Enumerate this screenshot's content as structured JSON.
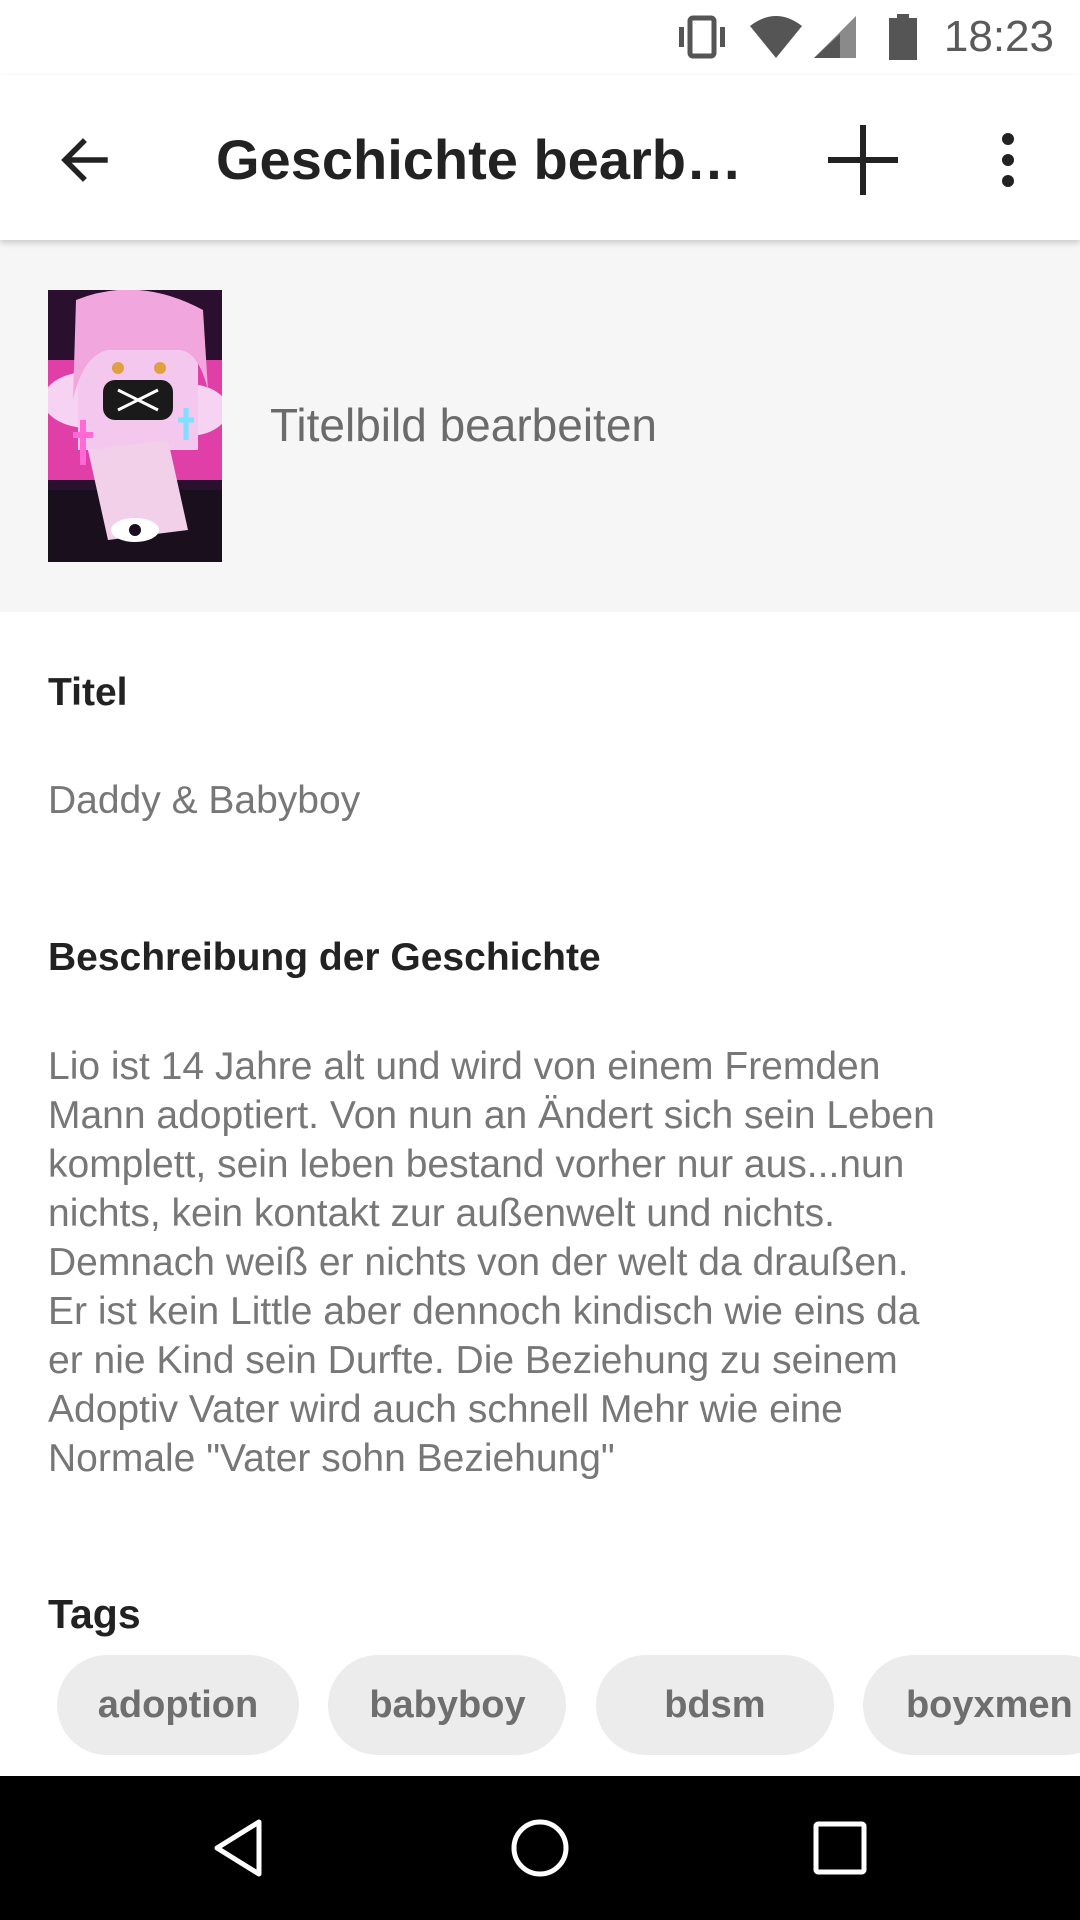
{
  "status_bar": {
    "time": "18:23",
    "icons": [
      "vibrate-icon",
      "wifi-icon",
      "cellular-signal-icon",
      "battery-icon"
    ]
  },
  "app_bar": {
    "title": "Geschichte bearbe…",
    "back_icon": "arrow-back-icon",
    "add_icon": "plus-icon",
    "more_icon": "more-vert-icon"
  },
  "cover": {
    "label": "Titelbild bearbeiten"
  },
  "title_field": {
    "label": "Titel",
    "value": "Daddy & Babyboy"
  },
  "description_field": {
    "label": "Beschreibung der Geschichte",
    "lines": [
      "Lio ist 14 Jahre alt und wird von einem Fremden",
      "Mann adoptiert. Von nun an Ändert sich sein Leben",
      "komplett, sein leben bestand vorher nur aus...nun",
      "nichts, kein kontakt zur außenwelt und nichts.",
      "Demnach weiß er nichts von der welt da draußen.",
      "Er ist kein Little aber dennoch kindisch wie eins da",
      "er nie Kind sein Durfte. Die Beziehung zu seinem",
      "Adoptiv Vater wird auch schnell Mehr wie eine",
      "Normale \"Vater sohn Beziehung\""
    ]
  },
  "tags": {
    "label": "Tags",
    "items": [
      "adoption",
      "babyboy",
      "bdsm",
      "boyxmen"
    ]
  },
  "nav_bar": {
    "icons": [
      "nav-back-icon",
      "nav-home-icon",
      "nav-recents-icon"
    ]
  },
  "colors": {
    "accent_text": "#222222",
    "secondary_text": "#777777",
    "chip_background": "#ececec",
    "cover_section_background": "#f6f6f6"
  }
}
